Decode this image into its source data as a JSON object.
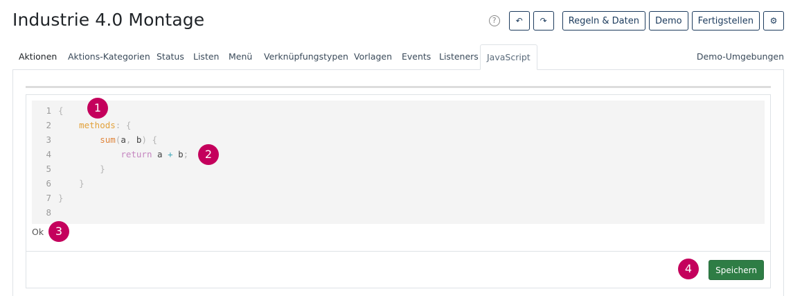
{
  "header": {
    "title": "Industrie 4.0 Montage",
    "help_glyph": "?",
    "undo_glyph": "↶",
    "redo_glyph": "↷",
    "rules_label": "Regeln & Daten",
    "demo_label": "Demo",
    "finish_label": "Fertigstellen",
    "settings_glyph": "⚙"
  },
  "tabs": [
    {
      "label": "Aktionen"
    },
    {
      "label": "Aktions-Kategorien"
    },
    {
      "label": "Status"
    },
    {
      "label": "Listen"
    },
    {
      "label": "Menü"
    },
    {
      "label": "Verknüpfungstypen"
    },
    {
      "label": "Vorlagen"
    },
    {
      "label": "Events"
    },
    {
      "label": "Listeners"
    },
    {
      "label": "JavaScript",
      "active": true
    }
  ],
  "tab_right": "Demo-Umgebungen",
  "editor": {
    "line_numbers": [
      "1",
      "2",
      "3",
      "4",
      "5",
      "6",
      "7",
      "8"
    ],
    "tokens": {
      "open_brace": "{",
      "close_brace": "}",
      "methods": "methods",
      "colon_brace": ": {",
      "sum": "sum",
      "paren_open": "(",
      "arg_a": "a",
      "comma": ", ",
      "arg_b": "b",
      "paren_close_brace": ") {",
      "return_kw": "return",
      "expr_a": "a",
      "plus": "+",
      "expr_b": "b",
      "semicolon": ";"
    }
  },
  "status": "Ok",
  "save_label": "Speichern",
  "markers": [
    "1",
    "2",
    "3",
    "4"
  ],
  "colors": {
    "accent": "#1b3a5c",
    "save_green": "#2e7d45",
    "marker": "#c4005c",
    "editor_bg": "#f4f4f4"
  }
}
